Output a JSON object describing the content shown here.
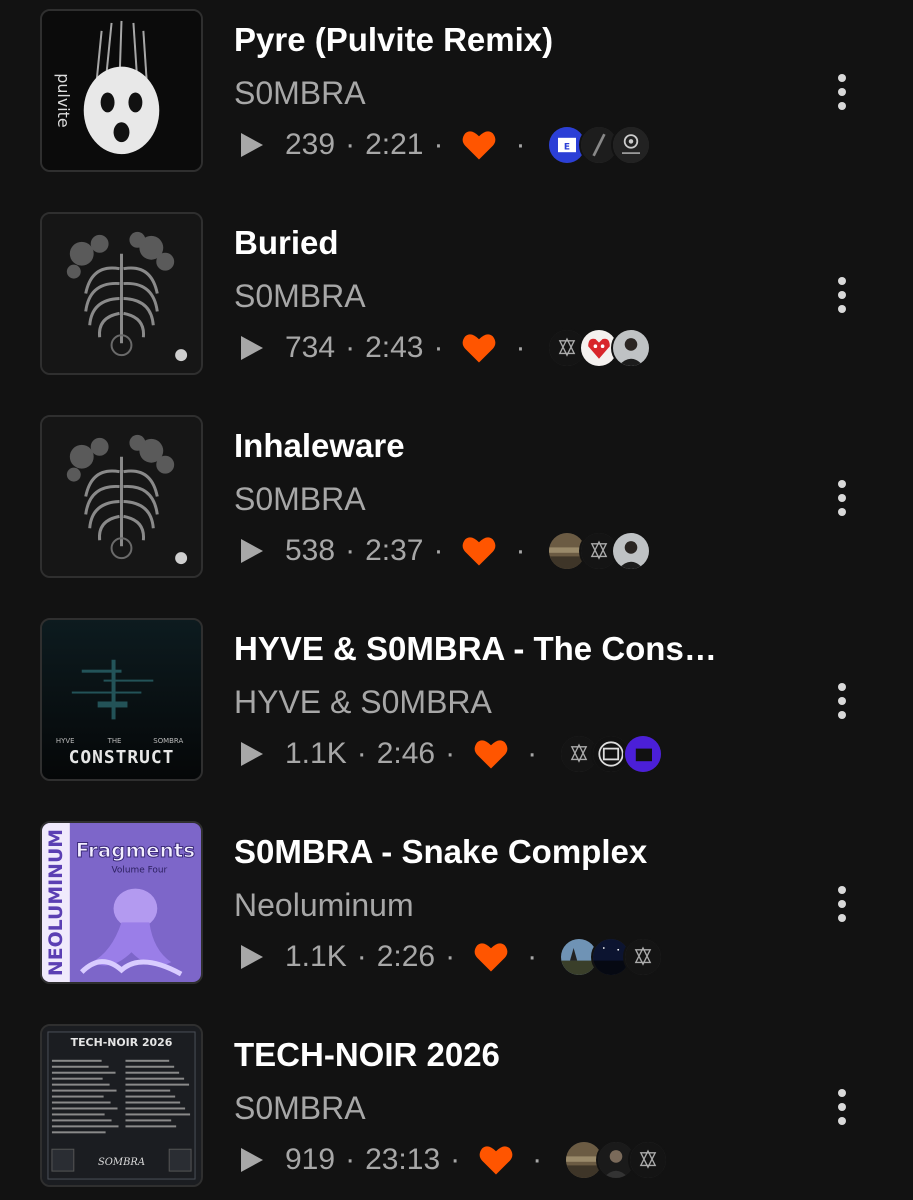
{
  "colors": {
    "background": "#121212",
    "title": "#ffffff",
    "secondary": "#a7a7a7",
    "like": "#ff5500"
  },
  "tracks": [
    {
      "title": "Pyre (Pulvite Remix)",
      "artist": "S0MBRA",
      "plays": "239",
      "duration": "2:21",
      "liked": true,
      "artwork": "pulvite-ghost-cover",
      "artwork_text": "pulvite",
      "likers": [
        "avatar-blue-logo",
        "avatar-dark-slash",
        "avatar-eye-logo"
      ]
    },
    {
      "title": "Buried",
      "artist": "S0MBRA",
      "plays": "734",
      "duration": "2:43",
      "liked": true,
      "artwork": "ribcage-flowers-cover",
      "likers": [
        "avatar-sigil",
        "avatar-red-cartoon",
        "avatar-man-photo"
      ]
    },
    {
      "title": "Inhaleware",
      "artist": "S0MBRA",
      "plays": "538",
      "duration": "2:37",
      "liked": true,
      "artwork": "ribcage-flowers-cover",
      "likers": [
        "avatar-landscape",
        "avatar-sigil",
        "avatar-man-photo"
      ]
    },
    {
      "title": "HYVE & S0MBRA  - The Cons…",
      "artist": "HYVE & S0MBRA",
      "plays": "1.1K",
      "duration": "2:46",
      "liked": true,
      "artwork": "construct-cover",
      "artwork_text": "CONSTRUCT",
      "artwork_credits": [
        "HYVE",
        "THE",
        "SOMBRA"
      ],
      "likers": [
        "avatar-sigil",
        "avatar-white-emblem",
        "avatar-purple"
      ]
    },
    {
      "title": "S0MBRA  - Snake Complex",
      "artist": "Neoluminum",
      "plays": "1.1K",
      "duration": "2:26",
      "liked": true,
      "artwork": "fragments-volume-four-cover",
      "artwork_text": "Fragments",
      "artwork_subtitle": "Volume Four",
      "artwork_side": "NEOLUMINUM",
      "likers": [
        "avatar-landscape-sky",
        "avatar-night-sky",
        "avatar-sigil"
      ]
    },
    {
      "title": "TECH-NOIR 2026",
      "artist": "S0MBRA",
      "plays": "919",
      "duration": "23:13",
      "liked": true,
      "artwork": "tech-noir-tracklist-cover",
      "artwork_text": "TECH-NOIR 2026",
      "artwork_footer": "SOMBRA",
      "likers": [
        "avatar-landscape",
        "avatar-man-dark",
        "avatar-sigil"
      ]
    }
  ]
}
